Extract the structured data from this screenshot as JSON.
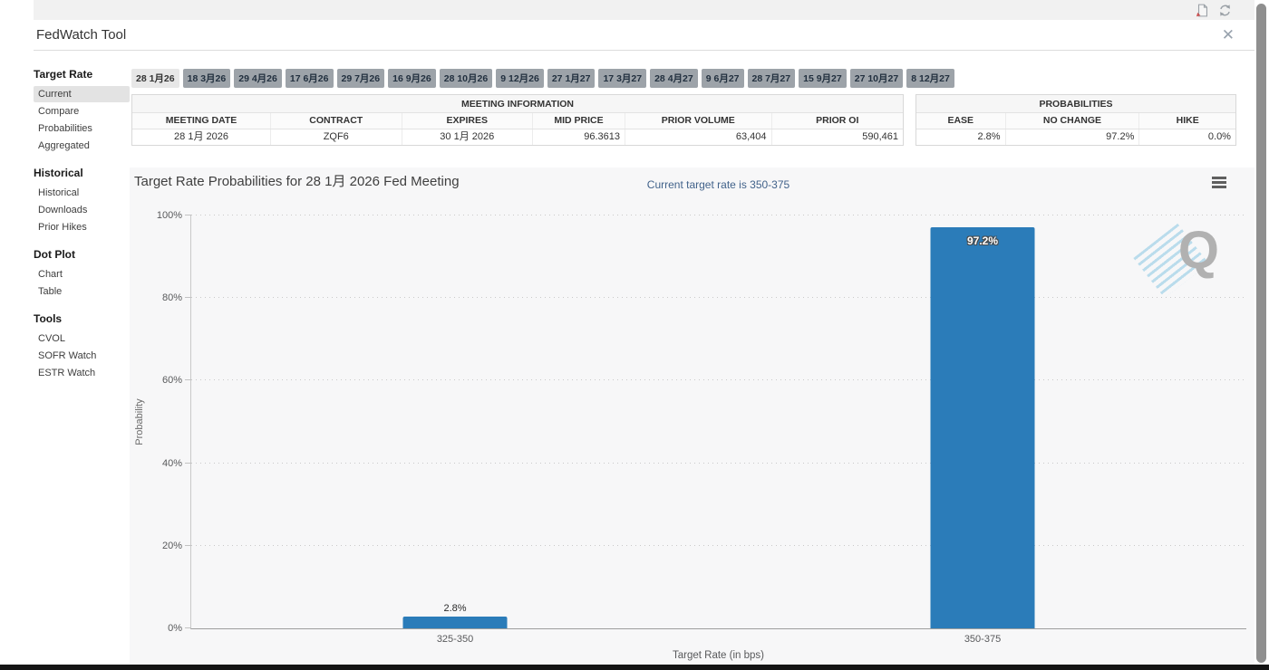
{
  "window": {
    "title": "FedWatch Tool"
  },
  "topbar": {
    "icons": [
      "export-report-icon",
      "refresh-icon"
    ],
    "close_glyph": "✕"
  },
  "sidebar": {
    "sections": [
      {
        "header": "Target Rate",
        "items": [
          {
            "label": "Current",
            "selected": true
          },
          {
            "label": "Compare",
            "selected": false
          },
          {
            "label": "Probabilities",
            "selected": false
          },
          {
            "label": "Aggregated",
            "selected": false
          }
        ]
      },
      {
        "header": "Historical",
        "items": [
          {
            "label": "Historical",
            "selected": false
          },
          {
            "label": "Downloads",
            "selected": false
          },
          {
            "label": "Prior Hikes",
            "selected": false
          }
        ]
      },
      {
        "header": "Dot Plot",
        "items": [
          {
            "label": "Chart",
            "selected": false
          },
          {
            "label": "Table",
            "selected": false
          }
        ]
      },
      {
        "header": "Tools",
        "items": [
          {
            "label": "CVOL",
            "selected": false
          },
          {
            "label": "SOFR Watch",
            "selected": false
          },
          {
            "label": "ESTR Watch",
            "selected": false
          }
        ]
      }
    ]
  },
  "tabs": {
    "selected_index": 0,
    "items": [
      "28 1月26",
      "18 3月26",
      "29 4月26",
      "17 6月26",
      "29 7月26",
      "16 9月26",
      "28 10月26",
      "9 12月26",
      "27 1月27",
      "17 3月27",
      "28 4月27",
      "9 6月27",
      "28 7月27",
      "15 9月27",
      "27 10月27",
      "8 12月27"
    ]
  },
  "meeting_info": {
    "title": "MEETING INFORMATION",
    "columns": [
      "MEETING DATE",
      "CONTRACT",
      "EXPIRES",
      "MID PRICE",
      "PRIOR VOLUME",
      "PRIOR OI"
    ],
    "values": [
      "28 1月 2026",
      "ZQF6",
      "30 1月 2026",
      "96.3613",
      "63,404",
      "590,461"
    ],
    "align": [
      "c",
      "c",
      "c",
      "r",
      "r",
      "r"
    ]
  },
  "probabilities": {
    "title": "PROBABILITIES",
    "columns": [
      "EASE",
      "NO CHANGE",
      "HIKE"
    ],
    "values": [
      "2.8%",
      "97.2%",
      "0.0%"
    ],
    "align": [
      "r",
      "r",
      "r"
    ]
  },
  "chart_data": {
    "type": "bar",
    "title": "Target Rate Probabilities for 28 1月 2026 Fed Meeting",
    "subtitle": "Current target rate is 350-375",
    "categories": [
      "325-350",
      "350-375"
    ],
    "values": [
      2.8,
      97.2
    ],
    "value_labels": [
      "2.8%",
      "97.2%"
    ],
    "xlabel": "Target Rate (in bps)",
    "ylabel": "Probability",
    "ylim": [
      0,
      100
    ],
    "yticks": [
      "0%",
      "20%",
      "40%",
      "60%",
      "80%",
      "100%"
    ],
    "grid": "dotted-horizontal",
    "legend": "none",
    "bar_color": "#2b7cb9",
    "watermark": "Q"
  }
}
